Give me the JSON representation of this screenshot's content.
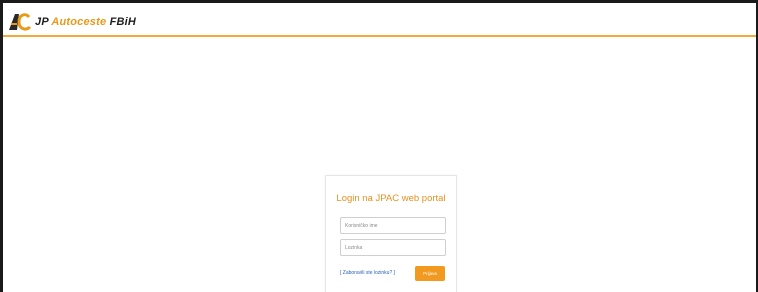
{
  "header": {
    "logo_jp": "JP",
    "logo_autoceste": "Autoceste",
    "logo_fbih": "FBiH"
  },
  "login": {
    "title": "Login na JPAC web portal",
    "username_placeholder": "Korisničko ime",
    "password_placeholder": "Lozinka",
    "forgot_link": "[ Zaboravili ste lozinku? ]",
    "submit_label": "Prijava"
  },
  "colors": {
    "accent": "#f19a1f",
    "title": "#e8901e",
    "link": "#2a63b8"
  },
  "icons": {
    "logo": "ac-logo-icon"
  }
}
